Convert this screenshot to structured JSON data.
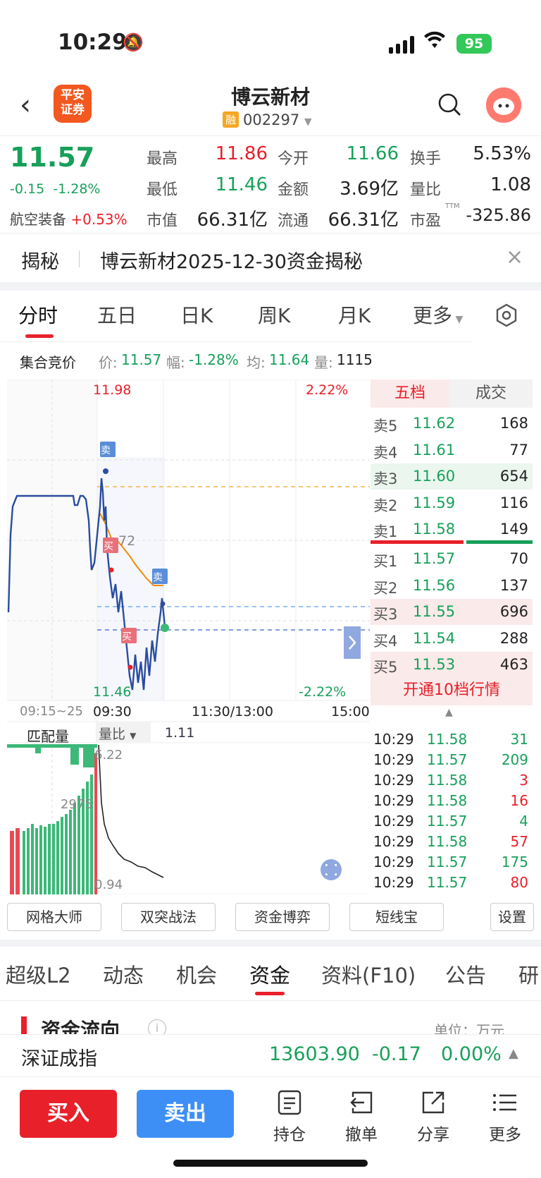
{
  "status": {
    "time": "10:29",
    "battery": "95"
  },
  "header": {
    "logo_line1": "平安",
    "logo_line2": "证券",
    "title": "博云新材",
    "margin_tag": "融",
    "code": "002297"
  },
  "quote": {
    "price": "11.57",
    "change": "-0.15",
    "change_pct": "-1.28%",
    "sector": "航空装备",
    "sector_pct": "+0.53%",
    "high_label": "最高",
    "high": "11.86",
    "open_label": "今开",
    "open": "11.66",
    "turnover_label": "换手",
    "turnover": "5.53%",
    "low_label": "最低",
    "low": "11.46",
    "amount_label": "金额",
    "amount": "3.69亿",
    "vol_ratio_label": "量比",
    "vol_ratio": "1.08",
    "mcap_label": "市值",
    "mcap": "66.31亿",
    "float_label": "流通",
    "float_cap": "66.31亿",
    "pe_label": "市盈",
    "pe_tag": "TTM",
    "pe": "-325.86"
  },
  "notice": {
    "tag": "揭秘",
    "text": "博云新材2025-12-30资金揭秘"
  },
  "tabs": [
    "分时",
    "五日",
    "日K",
    "周K",
    "月K",
    "更多"
  ],
  "infobar": {
    "label": "集合竞价",
    "price_label": "价:",
    "price": "11.57",
    "amp_label": "幅:",
    "amp": "-1.28%",
    "avg_label": "均:",
    "avg": "11.64",
    "vol_label": "量:",
    "vol": "1115"
  },
  "chart": {
    "top_price": "11.98",
    "top_pct": "2.22%",
    "bottom_price": "11.46",
    "bottom_pct": "-2.22%",
    "mid_label": "72",
    "time_labels": [
      "09:15~25",
      "09:30",
      "11:30/13:00",
      "15:00"
    ],
    "sub_left": "匹配量",
    "sub_ratio_label": "量比",
    "sub_ratio": "1.11",
    "sub_top": "6.22",
    "sub_mid": "2975",
    "sub_bottom": "0.94",
    "mark_sell": "卖",
    "mark_buy": "买"
  },
  "orderbook": {
    "tab_active": "五档",
    "tab_other": "成交",
    "asks": [
      {
        "label": "卖5",
        "price": "11.62",
        "vol": "168"
      },
      {
        "label": "卖4",
        "price": "11.61",
        "vol": "77"
      },
      {
        "label": "卖3",
        "price": "11.60",
        "vol": "654"
      },
      {
        "label": "卖2",
        "price": "11.59",
        "vol": "116"
      },
      {
        "label": "卖1",
        "price": "11.58",
        "vol": "149"
      }
    ],
    "bids": [
      {
        "label": "买1",
        "price": "11.57",
        "vol": "70"
      },
      {
        "label": "买2",
        "price": "11.56",
        "vol": "137"
      },
      {
        "label": "买3",
        "price": "11.55",
        "vol": "696"
      },
      {
        "label": "买4",
        "price": "11.54",
        "vol": "288"
      },
      {
        "label": "买5",
        "price": "11.53",
        "vol": "463"
      }
    ],
    "upgrade": "开通10档行情",
    "ticks": [
      {
        "t": "10:29",
        "p": "11.58",
        "v": "31",
        "c": "green"
      },
      {
        "t": "10:29",
        "p": "11.57",
        "v": "209",
        "c": "green"
      },
      {
        "t": "10:29",
        "p": "11.58",
        "v": "3",
        "c": "red"
      },
      {
        "t": "10:29",
        "p": "11.58",
        "v": "16",
        "c": "red"
      },
      {
        "t": "10:29",
        "p": "11.57",
        "v": "4",
        "c": "green"
      },
      {
        "t": "10:29",
        "p": "11.58",
        "v": "57",
        "c": "red"
      },
      {
        "t": "10:29",
        "p": "11.57",
        "v": "175",
        "c": "green"
      },
      {
        "t": "10:29",
        "p": "11.57",
        "v": "80",
        "c": "red"
      }
    ]
  },
  "tools": [
    "网格大师",
    "双突战法",
    "资金博弈",
    "短线宝",
    "设置"
  ],
  "bottom_tabs": [
    "超级L2",
    "动态",
    "机会",
    "资金",
    "资料(F10)",
    "公告",
    "研"
  ],
  "sub_section": {
    "title": "资金流向",
    "unit": "单位：万元"
  },
  "index": {
    "name": "深证成指",
    "value": "13603.90",
    "change": "-0.17",
    "pct": "0.00%"
  },
  "actions": {
    "buy": "买入",
    "sell": "卖出",
    "hold": "持仓",
    "cancel": "撤单",
    "share": "分享",
    "more": "更多"
  },
  "colors": {
    "up": "#e8202a",
    "down": "#18a05a",
    "accent": "#3d8ff5"
  }
}
